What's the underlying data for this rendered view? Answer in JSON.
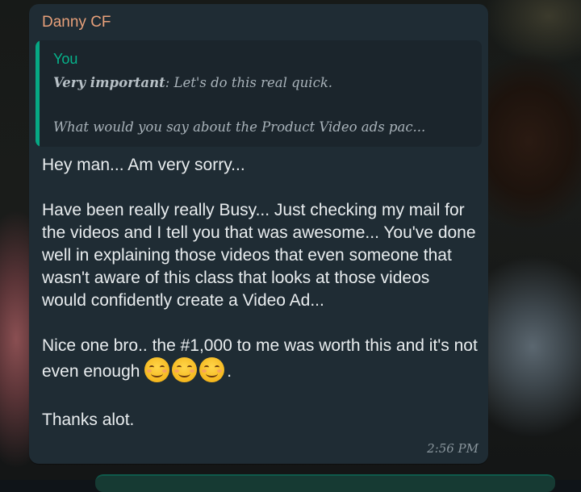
{
  "message": {
    "sender": "Danny CF",
    "quote": {
      "author": "You",
      "line1_bold": "Very important",
      "line1_rest": ": Let's do this real quick.",
      "line2": "What would you say about the Product Video ads pac..."
    },
    "paragraphs": [
      "Hey man... Am very sorry...",
      "Have been really really Busy... Just checking my mail for the videos and I tell you that was awesome... You've done well in explaining those videos that even someone that wasn't aware of this class that looks at those videos would confidently create a Video Ad...",
      "Nice one bro.. the #1,000 to me was worth this and it's not even enough",
      ".",
      "Thanks alot."
    ],
    "emojis": [
      "smiling-face-with-smiling-eyes",
      "smiling-face-with-smiling-eyes",
      "smiling-face-with-smiling-eyes"
    ],
    "time": "2:56 PM"
  },
  "colors": {
    "bubble_bg": "#1f2c34",
    "sender_name": "#e7a07a",
    "quote_accent": "#06a884",
    "text": "#e9edef",
    "meta": "#8a969d"
  }
}
